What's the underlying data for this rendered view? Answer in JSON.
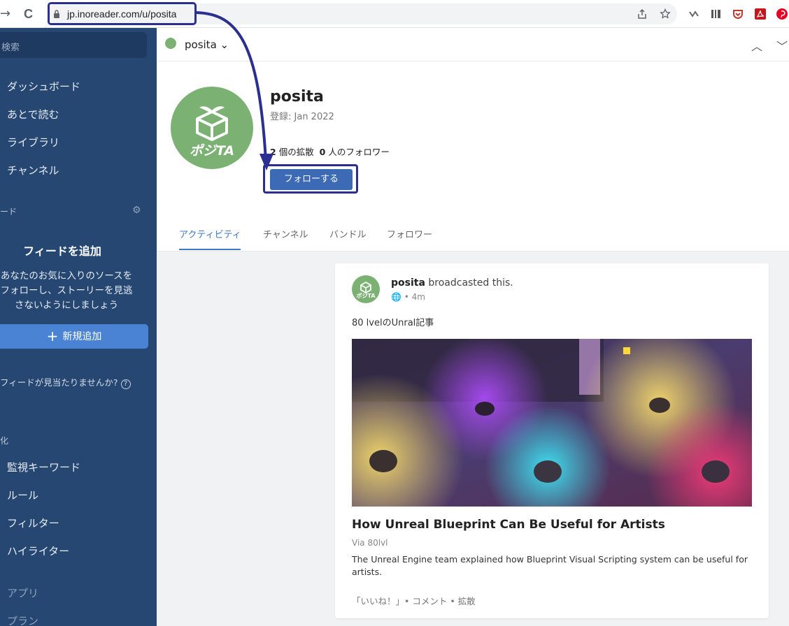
{
  "browser": {
    "url": "jp.inoreader.com/u/posita",
    "back_glyph": "→",
    "reload_glyph": "C"
  },
  "sidebar": {
    "search_placeholder": "検索",
    "items": [
      {
        "label": "ダッシュボード"
      },
      {
        "label": "あとで読む"
      },
      {
        "label": "ライブラリ"
      },
      {
        "label": "チャンネル"
      }
    ],
    "feeds_section": "ード",
    "add_feed_title": "フィードを追加",
    "add_feed_desc": "あなたのお気に入りのソースを フォローし、ストーリーを見逃 さないようにしましょう",
    "add_button": "新規追加",
    "missing_feed": "フィードが見当たりませんか?",
    "automation_section": "化",
    "automation_items": [
      {
        "label": "監視キーワード"
      },
      {
        "label": "ルール"
      },
      {
        "label": "フィルター"
      },
      {
        "label": "ハイライター"
      }
    ],
    "apps_label": "アプリ",
    "plans_label": "プラン"
  },
  "topbar": {
    "title": "posita",
    "caret": "⌄"
  },
  "profile": {
    "name": "posita",
    "joined": "登録: Jan 2022",
    "broadcasts_count": "2",
    "broadcasts_label": "個の拡散",
    "followers_count": "0",
    "followers_label": "人のフォロワー",
    "follow_button": "フォローする",
    "logo_text": "ポジTA"
  },
  "tabs": [
    {
      "label": "アクティビティ",
      "active": true
    },
    {
      "label": "チャンネル",
      "active": false
    },
    {
      "label": "バンドル",
      "active": false
    },
    {
      "label": "フォロワー",
      "active": false
    }
  ],
  "post": {
    "author": "posita",
    "action": "broadcasted this.",
    "time": "• 4m",
    "avatar_text": "ポジTA",
    "comment": "80 lvelのUnral記事",
    "title": "How Unreal Blueprint Can Be Useful for Artists",
    "via": "Via 80lvl",
    "description": "The Unreal Engine team explained how Blueprint Visual Scripting system can be useful for artists.",
    "actions": "「いいね！」• コメント • 拡散"
  },
  "colors": {
    "sidebar_bg": "#264772",
    "accent": "#3d6ab5",
    "annotation": "#2b2f8f",
    "avatar_green": "#7bb274"
  }
}
